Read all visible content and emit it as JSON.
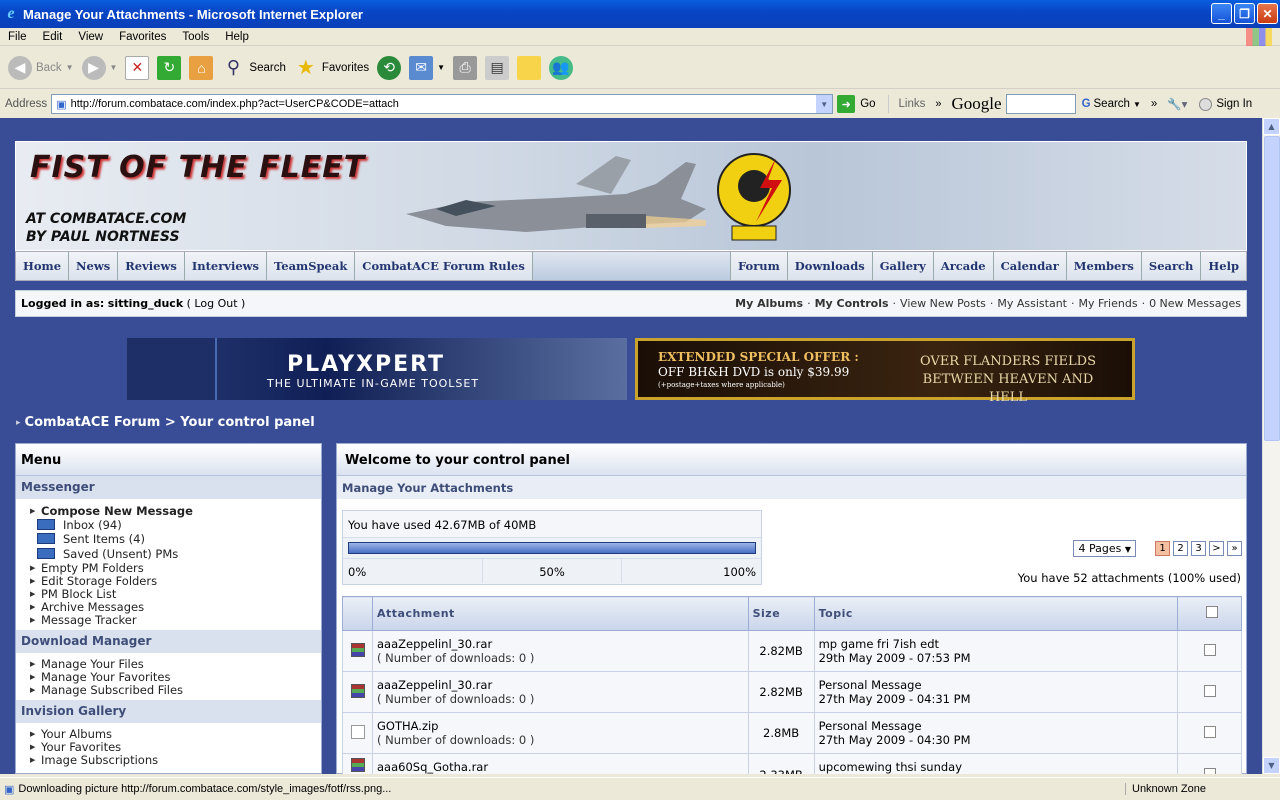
{
  "window": {
    "title": "Manage Your Attachments - Microsoft Internet Explorer"
  },
  "menubar": [
    "File",
    "Edit",
    "View",
    "Favorites",
    "Tools",
    "Help"
  ],
  "toolbar": {
    "back": "Back",
    "search": "Search",
    "favorites": "Favorites"
  },
  "address": {
    "label": "Address",
    "url": "http://forum.combatace.com/index.php?act=UserCP&CODE=attach",
    "go": "Go",
    "links": "Links",
    "google": "Google",
    "google_search": "Search",
    "sign_in": "Sign In"
  },
  "banner": {
    "title": "FIST OF THE FLEET",
    "line1": "AT COMBATACE.COM",
    "line2": "BY PAUL NORTNESS"
  },
  "nav_left": [
    "Home",
    "News",
    "Reviews",
    "Interviews",
    "TeamSpeak",
    "CombatACE Forum Rules"
  ],
  "nav_right": [
    "Forum",
    "Downloads",
    "Gallery",
    "Arcade",
    "Calendar",
    "Members",
    "Search",
    "Help"
  ],
  "userbar": {
    "logged_in_label": "Logged in as:",
    "username": "sitting_duck",
    "logout": "( Log Out )",
    "links": [
      "My Albums",
      "My Controls",
      "View New Posts",
      "My Assistant",
      "My Friends",
      "0 New Messages"
    ]
  },
  "ads": {
    "ad1_title": "PLAYXPERT",
    "ad1_sub": "THE ULTIMATE IN-GAME TOOLSET",
    "ad2_line1": "EXTENDED SPECIAL OFFER :",
    "ad2_line2": "OFF BH&H DVD is only $39.99",
    "ad2_line3": "(+postage+taxes where applicable)",
    "ad2_right1": "OVER FLANDERS FIELDS",
    "ad2_right2": "BETWEEN HEAVEN AND HELL"
  },
  "breadcrumb": "CombatACE Forum > Your control panel",
  "menu": {
    "header": "Menu",
    "sections": [
      {
        "title": "Messenger",
        "items": [
          "Compose New Message",
          "Inbox (94)",
          "Sent Items (4)",
          "Saved (Unsent) PMs",
          "Empty PM Folders",
          "Edit Storage Folders",
          "PM Block List",
          "Archive Messages",
          "Message Tracker"
        ]
      },
      {
        "title": "Download Manager",
        "items": [
          "Manage Your Files",
          "Manage Your Favorites",
          "Manage Subscribed Files"
        ]
      },
      {
        "title": "Invision Gallery",
        "items": [
          "Your Albums",
          "Your Favorites",
          "Image Subscriptions"
        ]
      }
    ]
  },
  "main": {
    "title": "Welcome to your control panel",
    "subtitle": "Manage Your Attachments",
    "usage_text": "You have used 42.67MB of 40MB",
    "usage_fraction": 1.0,
    "ticks": [
      "0%",
      "50%",
      "100%"
    ],
    "pages_label": "4 Pages",
    "pages": [
      "1",
      "2",
      "3",
      ">",
      "»"
    ],
    "count_text": "You have 52 attachments (100% used)",
    "columns": [
      "Attachment",
      "Size",
      "Topic"
    ],
    "rows": [
      {
        "name": "aaaZeppelinl_30.rar",
        "downloads": "( Number of downloads: 0 )",
        "size": "2.82MB",
        "topic": "mp game fri 7ish edt",
        "date": "29th May 2009 - 07:53 PM",
        "icon": "rar"
      },
      {
        "name": "aaaZeppelinl_30.rar",
        "downloads": "( Number of downloads: 0 )",
        "size": "2.82MB",
        "topic": "Personal Message",
        "date": "27th May 2009 - 04:31 PM",
        "icon": "rar"
      },
      {
        "name": "GOTHA.zip",
        "downloads": "( Number of downloads: 0 )",
        "size": "2.8MB",
        "topic": "Personal Message",
        "date": "27th May 2009 - 04:30 PM",
        "icon": "zip"
      },
      {
        "name": "aaa60Sq_Gotha.rar",
        "downloads": "",
        "size": "2.33MB",
        "topic": "upcomewing thsi sunday",
        "date": "",
        "icon": "rar"
      }
    ]
  },
  "status": {
    "text": "Downloading picture http://forum.combatace.com/style_images/fotf/rss.png...",
    "zone": "Unknown Zone"
  }
}
